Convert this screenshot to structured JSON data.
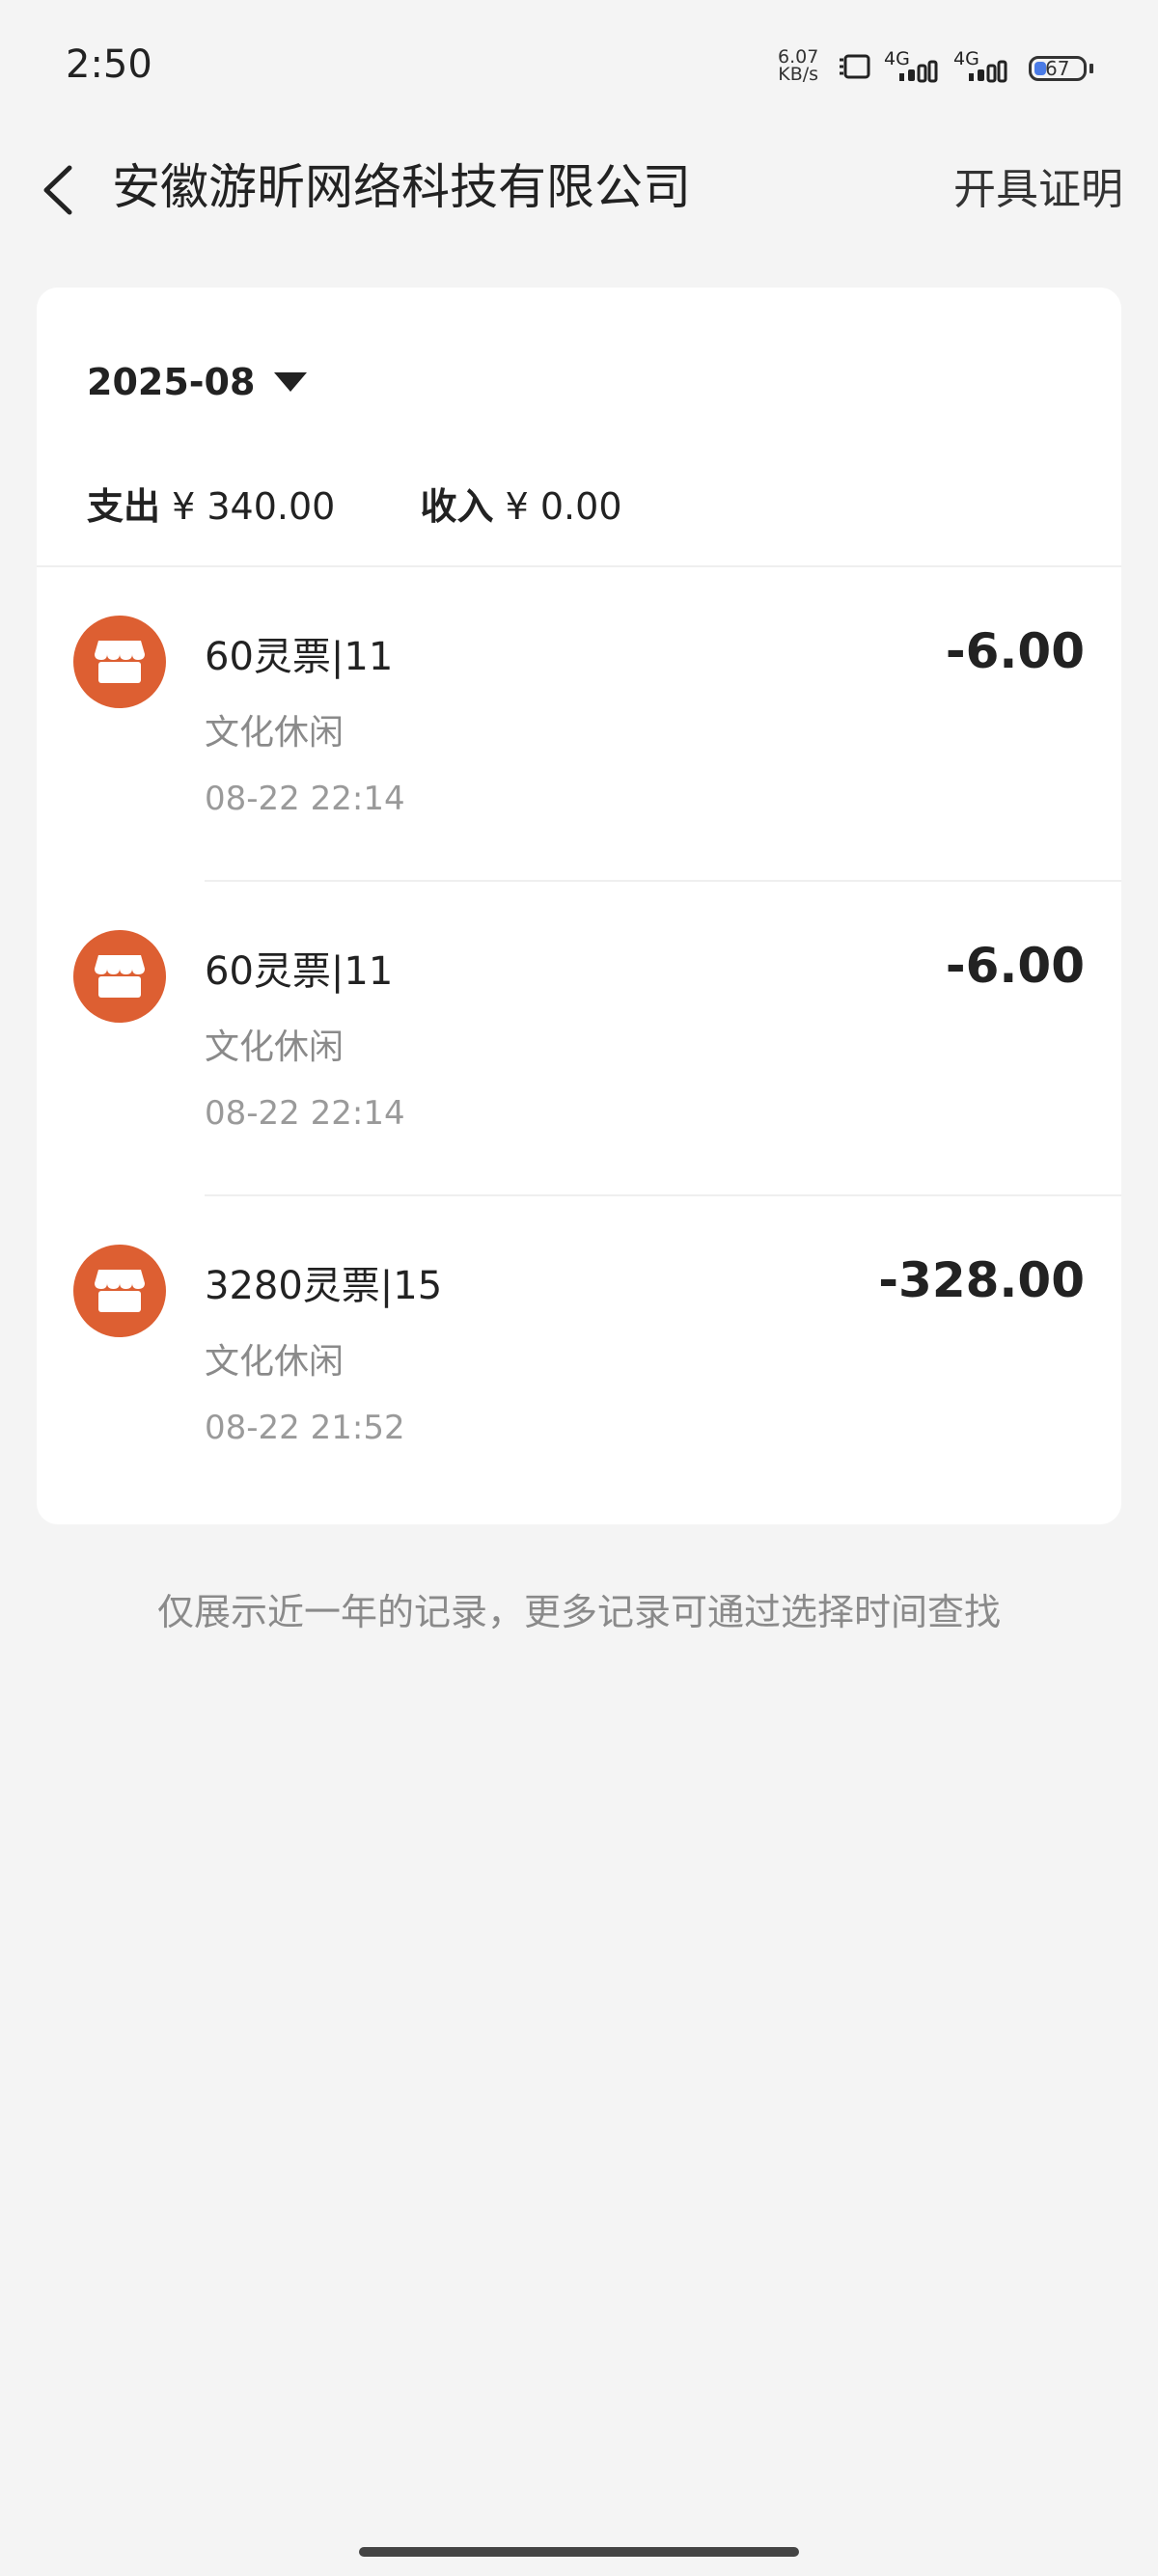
{
  "status_bar": {
    "time": "2:50",
    "net_speed_value": "6.07",
    "net_speed_unit": "KB/s",
    "signal1": "4G",
    "signal2": "4G",
    "battery": "67"
  },
  "header": {
    "title": "安徽游昕网络科技有限公司",
    "cert_label": "开具证明",
    "back_icon": "chevron-left-icon"
  },
  "summary": {
    "month": "2025-08",
    "expense_label": "支出",
    "expense_value": "¥ 340.00",
    "income_label": "收入",
    "income_value": "¥ 0.00"
  },
  "transactions": [
    {
      "name": "60灵票|11",
      "category": "文化休闲",
      "datetime": "08-22 22:14",
      "amount": "-6.00",
      "icon": "store-icon"
    },
    {
      "name": "60灵票|11",
      "category": "文化休闲",
      "datetime": "08-22 22:14",
      "amount": "-6.00",
      "icon": "store-icon"
    },
    {
      "name": "3280灵票|15",
      "category": "文化休闲",
      "datetime": "08-22 21:52",
      "amount": "-328.00",
      "icon": "store-icon"
    }
  ],
  "footnote": "仅展示近一年的记录，更多记录可通过选择时间查找",
  "colors": {
    "accent_avatar": "#dd5f32",
    "background": "#f4f4f4"
  }
}
